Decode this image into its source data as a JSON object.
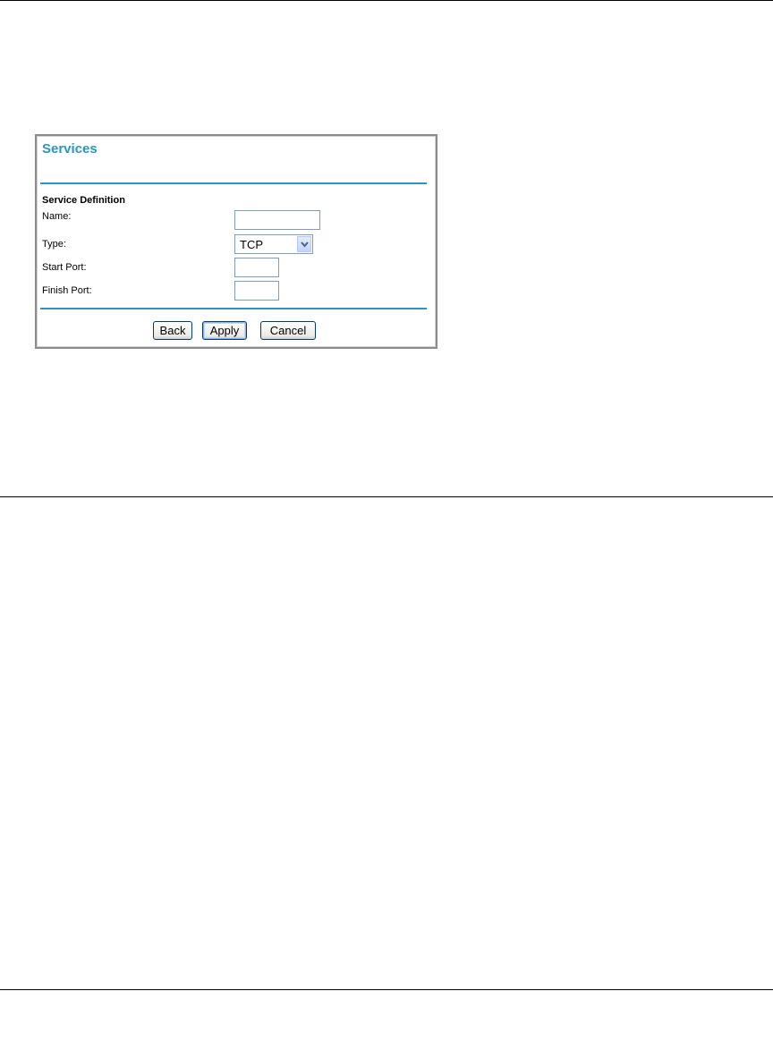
{
  "panel": {
    "title": "Services",
    "section_heading": "Service Definition",
    "fields": {
      "name": {
        "label": "Name:",
        "value": ""
      },
      "type": {
        "label": "Type:",
        "selected": "TCP"
      },
      "start_port": {
        "label": "Start Port:",
        "value": ""
      },
      "finish_port": {
        "label": "Finish Port:",
        "value": ""
      }
    },
    "buttons": {
      "back": "Back",
      "apply": "Apply",
      "cancel": "Cancel"
    }
  },
  "colors": {
    "accent": "#2a97b8",
    "panel_border": "#8c8c8c",
    "input_border": "#7f9db9"
  },
  "icons": {
    "select_arrow": "chevron-down-icon"
  }
}
